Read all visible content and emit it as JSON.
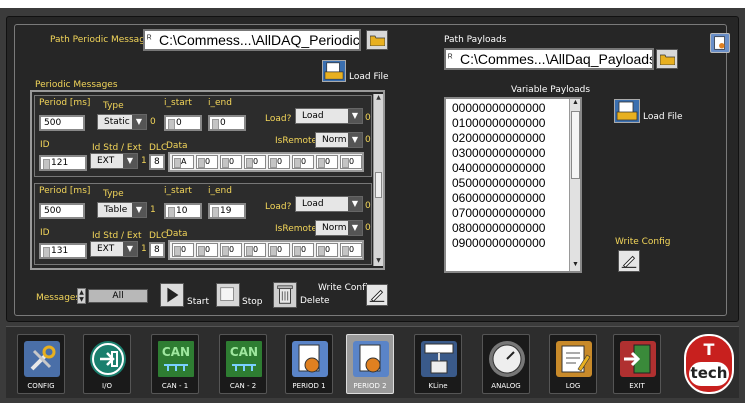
{
  "periodic": {
    "path_label": "Path Periodic Messages",
    "path_value": "C:\\Commess...\\AllDAQ_Periodic.txt",
    "section_label": "Periodic Messages",
    "load_file_label": "Load File",
    "messages": [
      {
        "period_label": "Period [ms]",
        "period": "500",
        "type_label": "Type",
        "type": "Static",
        "type_index": "0",
        "istart_label": "i_start",
        "istart": "0",
        "iend_label": "i_end",
        "iend": "0",
        "load_label": "Load?",
        "load": "Load",
        "load_index": "0",
        "id_label": "ID",
        "id": "121",
        "idstd_label": "Id Std / Ext",
        "idstd": "EXT",
        "idstd_index": "1",
        "dlc_label": "DLC",
        "dlc": "8",
        "data_label": "Data",
        "isremote_label": "IsRemote?",
        "isremote": "Norm",
        "isremote_index": "0",
        "data": [
          "A",
          "0",
          "0",
          "0",
          "0",
          "0",
          "0",
          "0"
        ]
      },
      {
        "period_label": "Period [ms]",
        "period": "500",
        "type_label": "Type",
        "type": "Table",
        "type_index": "1",
        "istart_label": "i_start",
        "istart": "10",
        "iend_label": "i_end",
        "iend": "19",
        "load_label": "Load?",
        "load": "Load",
        "load_index": "0",
        "id_label": "ID",
        "id": "131",
        "idstd_label": "Id Std / Ext",
        "idstd": "EXT",
        "idstd_index": "1",
        "dlc_label": "DLC",
        "dlc": "8",
        "data_label": "Data",
        "isremote_label": "IsRemote?",
        "isremote": "Norm",
        "isremote_index": "0",
        "data": [
          "0",
          "0",
          "0",
          "0",
          "0",
          "0",
          "0",
          "0"
        ]
      }
    ],
    "messages_label": "Messages",
    "messages_selector": "All",
    "start_label": "Start",
    "stop_label": "Stop",
    "delete_label": "Delete",
    "write_config_label": "Write Config"
  },
  "payloads": {
    "path_label": "Path Payloads",
    "path_value": "C:\\Commes...\\AllDaq_Payloads.txt",
    "list_label": "Variable Payloads",
    "load_file_label": "Load File",
    "write_config_label": "Write Config",
    "items": [
      "00000000000000",
      "01000000000000",
      "02000000000000",
      "03000000000000",
      "04000000000000",
      "05000000000000",
      "06000000000000",
      "07000000000000",
      "08000000000000",
      "09000000000000"
    ]
  },
  "nav": [
    {
      "label": "CONFIG",
      "icon": "config-tools-icon",
      "color": "#4a6fa8"
    },
    {
      "label": "I/O",
      "icon": "io-arrow-icon",
      "color": "#1a7f6e"
    },
    {
      "label": "CAN - 1",
      "icon": "can-bus-icon",
      "color": "#2e7d32"
    },
    {
      "label": "CAN - 2",
      "icon": "can-bus-icon",
      "color": "#2e7d32"
    },
    {
      "label": "PERIOD 1",
      "icon": "periodic-clock-icon",
      "color": "#5a84c8"
    },
    {
      "label": "PERIOD 2",
      "icon": "periodic-clock-icon",
      "color": "#5a84c8"
    },
    {
      "label": "KLine",
      "icon": "kline-terminal-icon",
      "color": "#3a5a8a"
    },
    {
      "label": "ANALOG",
      "icon": "gauge-icon",
      "color": "#777777"
    },
    {
      "label": "LOG",
      "icon": "log-notepad-icon",
      "color": "#c88a2a"
    },
    {
      "label": "EXIT",
      "icon": "exit-door-icon",
      "color": "#b03030"
    }
  ],
  "brand": {
    "text": "tech",
    "letter": "T",
    "color": "#c8201e"
  },
  "colors": {
    "label_yellow": "#f3d65a",
    "panel_bg": "#262626",
    "frame_bg": "#3b3b3b"
  }
}
